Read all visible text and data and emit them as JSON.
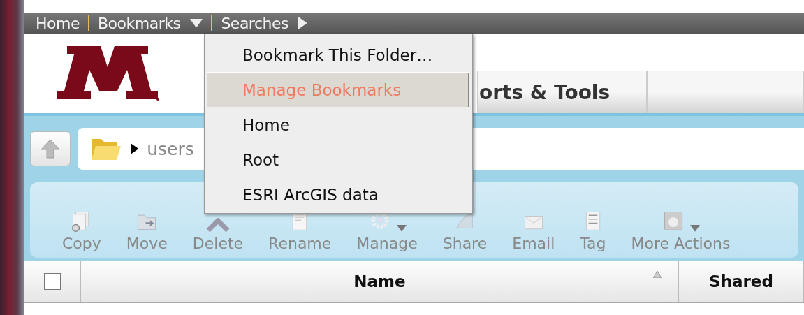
{
  "nav": {
    "items": [
      {
        "label": "Home",
        "kind": "link"
      },
      {
        "label": "Bookmarks",
        "kind": "dropdown",
        "expanded": true
      },
      {
        "label": "Searches",
        "kind": "submenu"
      }
    ]
  },
  "bookmarks_menu": {
    "items": [
      {
        "label": "Bookmark This Folder…",
        "selected": false
      },
      {
        "label": "Manage Bookmarks",
        "selected": true
      },
      {
        "label": "Home",
        "selected": false
      },
      {
        "label": "Root",
        "selected": false
      },
      {
        "label": "ESRI ArcGIS data",
        "selected": false
      }
    ]
  },
  "tabs": [
    {
      "label": "orts & Tools"
    }
  ],
  "path": {
    "segments": [
      "users"
    ]
  },
  "toolbar": {
    "buttons": [
      {
        "label": "Copy",
        "dropdown": false
      },
      {
        "label": "Move",
        "dropdown": false
      },
      {
        "label": "Delete",
        "dropdown": false
      },
      {
        "label": "Rename",
        "dropdown": false
      },
      {
        "label": "Manage",
        "dropdown": true
      },
      {
        "label": "Share",
        "dropdown": false
      },
      {
        "label": "Email",
        "dropdown": false
      },
      {
        "label": "Tag",
        "dropdown": false
      },
      {
        "label": "More Actions",
        "dropdown": true
      }
    ]
  },
  "table": {
    "select_all_checked": false,
    "columns": [
      {
        "label": "Name",
        "sorted": true
      },
      {
        "label": "Shared",
        "sorted": false
      }
    ]
  }
}
